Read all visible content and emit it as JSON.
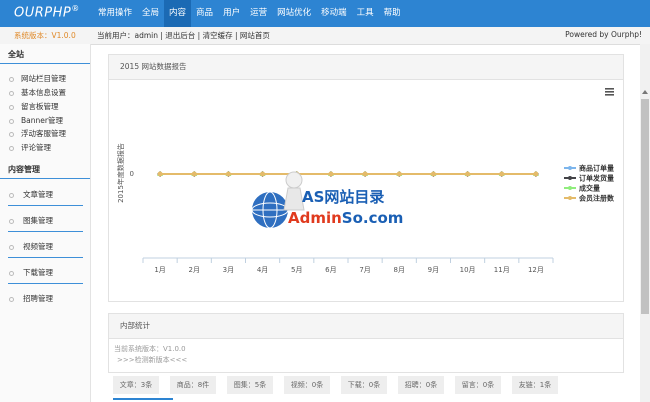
{
  "app": {
    "logo": "OURPHP",
    "logo_mark": "®"
  },
  "nav": {
    "items": [
      {
        "label": "常用操作",
        "active": false
      },
      {
        "label": "全局",
        "active": false
      },
      {
        "label": "内容",
        "active": true
      },
      {
        "label": "商品",
        "active": false
      },
      {
        "label": "用户",
        "active": false
      },
      {
        "label": "运营",
        "active": false
      },
      {
        "label": "网站优化",
        "active": false
      },
      {
        "label": "移动端",
        "active": false
      },
      {
        "label": "工具",
        "active": false
      },
      {
        "label": "帮助",
        "active": false
      }
    ]
  },
  "subbar": {
    "version": "系统版本：V1.0.0",
    "current_user_label": "当前用户：",
    "username": "admin",
    "sep": " | ",
    "logout": "退出后台",
    "clear_cache": "清空缓存",
    "site_home": "网站首页",
    "powered": "Powered by Ourphp!"
  },
  "sidebar": {
    "global_title": "全站",
    "global_items": [
      "网站栏目管理",
      "基本信息设置",
      "留言板管理",
      "Banner管理",
      "浮动客服管理",
      "评论管理"
    ],
    "content_title": "内容管理",
    "content_items": [
      "文章管理",
      "图集管理",
      "视频管理",
      "下载管理",
      "招聘管理"
    ]
  },
  "chart_panel": {
    "title": "2015 网站数据报告",
    "menu_icon": "menu-icon"
  },
  "chart_data": {
    "type": "line",
    "title": "",
    "xlabel": "",
    "ylabel": "2015年度数据报告",
    "categories": [
      "1月",
      "2月",
      "3月",
      "4月",
      "5月",
      "6月",
      "7月",
      "8月",
      "9月",
      "10月",
      "11月",
      "12月"
    ],
    "y_ticks": [
      "0"
    ],
    "series": [
      {
        "name": "商品订单量",
        "color": "#7cb5ec",
        "marker": "diamond",
        "values": [
          0,
          0,
          0,
          0,
          0,
          0,
          0,
          0,
          0,
          0,
          0,
          0
        ]
      },
      {
        "name": "订单发货量",
        "color": "#434348",
        "marker": "diamond",
        "values": [
          0,
          0,
          0,
          0,
          0,
          0,
          0,
          0,
          0,
          0,
          0,
          0
        ]
      },
      {
        "name": "成交量",
        "color": "#90ed7d",
        "marker": "triangle",
        "values": [
          0,
          0,
          0,
          0,
          0,
          0,
          0,
          0,
          0,
          0,
          0,
          0
        ]
      },
      {
        "name": "会员注册数",
        "color": "#e4bb6a",
        "marker": "circle",
        "values": [
          0,
          0,
          0,
          0,
          0,
          0,
          0,
          0,
          0,
          0,
          0,
          0
        ]
      }
    ],
    "legend_position": "right",
    "grid": false
  },
  "watermark": {
    "line1": "AS网站目录",
    "line2_a": "Admin",
    "line2_b": "So.com"
  },
  "stats_panel": {
    "title": "内部统计",
    "current_version": "当前系统版本：V1.0.0",
    "check_version": ">>>检测新版本<<<",
    "boxes": [
      "文章：3条",
      "商品：8件",
      "图集：5条",
      "视频：0条",
      "下载：0条",
      "招聘：0条",
      "留言：0条",
      "友链：1条"
    ]
  }
}
